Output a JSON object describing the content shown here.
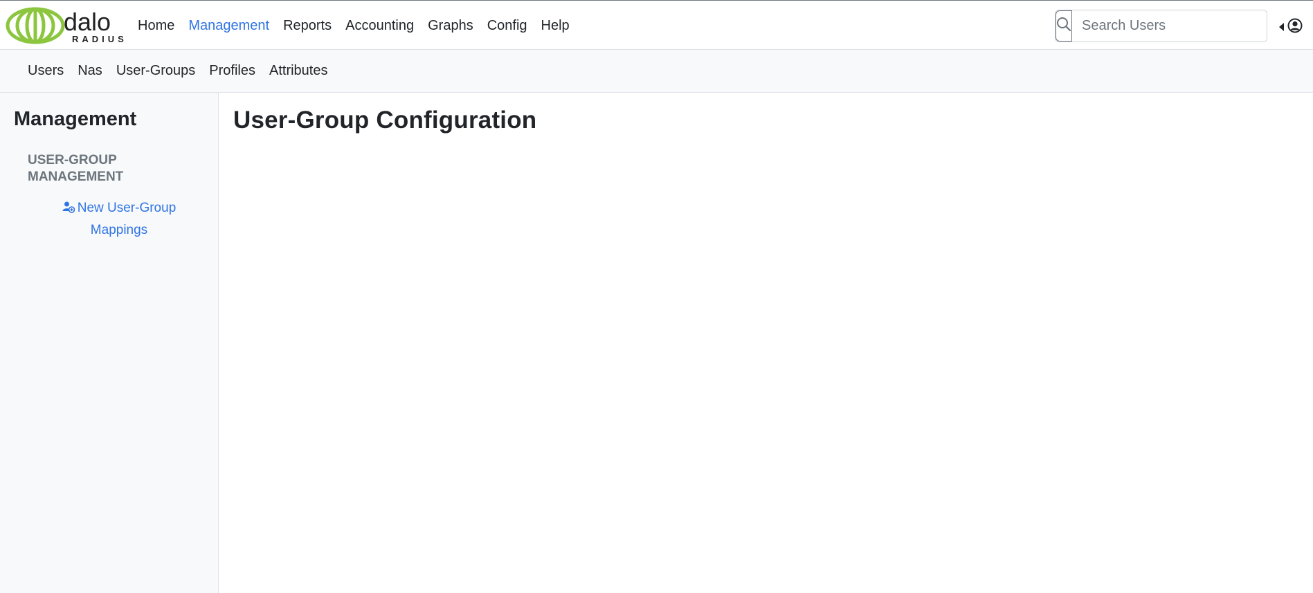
{
  "logo": {
    "text_main": "dalo",
    "text_sub": "RADIUS"
  },
  "main_nav": [
    {
      "label": "Home",
      "active": false
    },
    {
      "label": "Management",
      "active": true
    },
    {
      "label": "Reports",
      "active": false
    },
    {
      "label": "Accounting",
      "active": false
    },
    {
      "label": "Graphs",
      "active": false
    },
    {
      "label": "Config",
      "active": false
    },
    {
      "label": "Help",
      "active": false
    }
  ],
  "search": {
    "placeholder": "Search Users",
    "value": "",
    "icon": "search-icon"
  },
  "user_menu": {
    "icons": [
      "caret-left-icon",
      "user-circle-icon"
    ]
  },
  "sub_nav": [
    {
      "label": "Users"
    },
    {
      "label": "Nas"
    },
    {
      "label": "User-Groups"
    },
    {
      "label": "Profiles"
    },
    {
      "label": "Attributes"
    }
  ],
  "sidebar": {
    "title": "Management",
    "section": "USER-GROUP MANAGEMENT",
    "links": [
      {
        "label": "New User-Group Mappings",
        "icon": "user-plus-icon"
      }
    ]
  },
  "content": {
    "title": "User-Group Configuration"
  },
  "colors": {
    "accent": "#2f74e3",
    "logo_green": "#8cc63f",
    "sidebar_bg": "#f8f9fa",
    "muted": "#6c757d"
  }
}
